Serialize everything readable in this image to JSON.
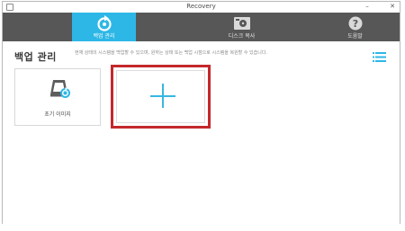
{
  "window": {
    "title": "Recovery"
  },
  "toolbar": {
    "tabs": [
      {
        "label": "백업 관리",
        "icon": "restore-icon",
        "active": true
      },
      {
        "label": "디스크 복사",
        "icon": "disk-icon",
        "active": false
      },
      {
        "label": "도움말",
        "icon": "help-icon",
        "active": false
      }
    ]
  },
  "main": {
    "heading": "백업 관리",
    "description": "현재 상태의 시스템을 백업할 수 있으며, 원하는 상태 또는 백업 시점으로 시스템을 복원할 수 있습니다.",
    "cards": [
      {
        "label": "초기 이미지",
        "icon": "initial-image-icon"
      }
    ],
    "add_card": {
      "icon": "plus-icon"
    }
  },
  "colors": {
    "accent": "#2db7e6",
    "toolbar": "#575757",
    "highlight": "#c4282c"
  }
}
